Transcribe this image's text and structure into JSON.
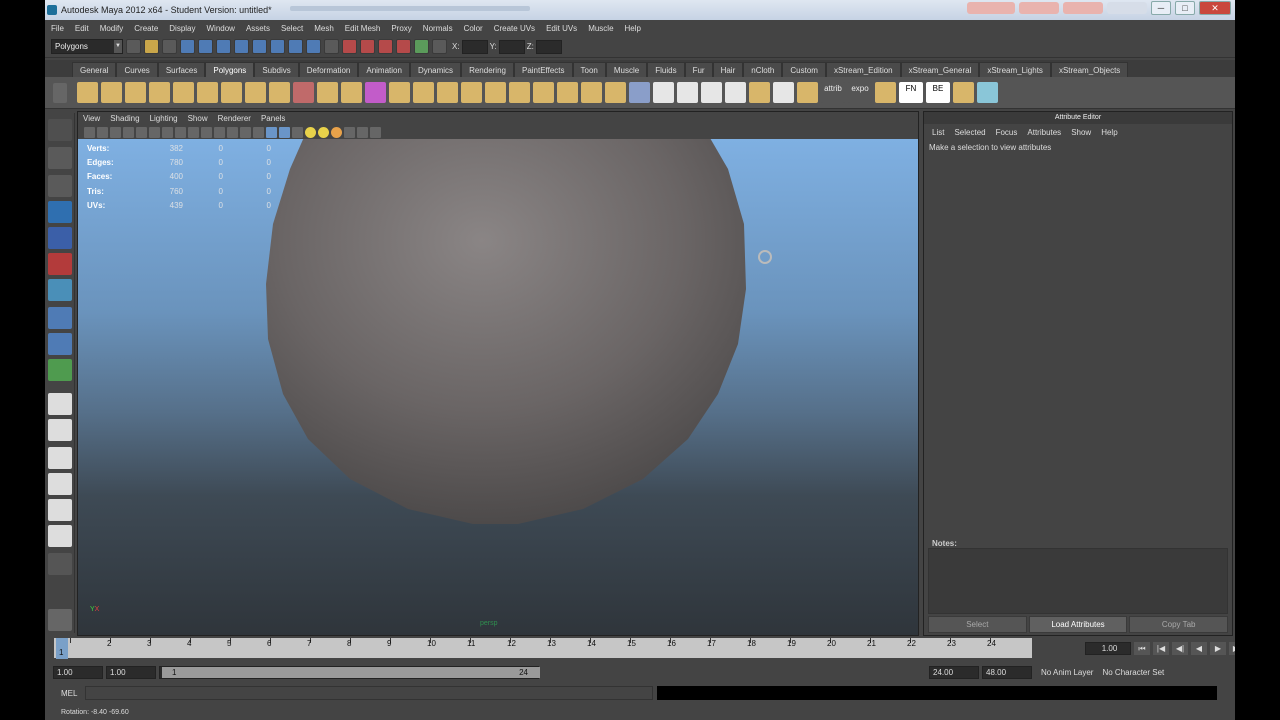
{
  "title_bar": {
    "text": "Autodesk Maya 2012 x64 - Student Version: untitled*",
    "minimize": "─",
    "maximize": "□",
    "close": "✕"
  },
  "menu": [
    "File",
    "Edit",
    "Modify",
    "Create",
    "Display",
    "Window",
    "Assets",
    "Select",
    "Mesh",
    "Edit Mesh",
    "Proxy",
    "Normals",
    "Color",
    "Create UVs",
    "Edit UVs",
    "Muscle",
    "Help"
  ],
  "status_line": {
    "mode": "Polygons",
    "x_label": "X:",
    "y_label": "Y:",
    "z_label": "Z:",
    "x_value": "",
    "y_value": "",
    "z_value": ""
  },
  "shelf_tabs": [
    "General",
    "Curves",
    "Surfaces",
    "Polygons",
    "Subdivs",
    "Deformation",
    "Animation",
    "Dynamics",
    "Rendering",
    "PaintEffects",
    "Toon",
    "Muscle",
    "Fluids",
    "Fur",
    "Hair",
    "nCloth",
    "Custom",
    "xStream_Edition",
    "xStream_General",
    "xStream_Lights",
    "xStream_Objects"
  ],
  "active_shelf_tab": "Polygons",
  "shelf_text_buttons": [
    "attrib",
    "expo",
    "FN",
    "BE"
  ],
  "viewport": {
    "menu": [
      "View",
      "Shading",
      "Lighting",
      "Show",
      "Renderer",
      "Panels"
    ],
    "hud": [
      {
        "label": "Verts:",
        "v1": "382",
        "v2": "0",
        "v3": "0"
      },
      {
        "label": "Edges:",
        "v1": "780",
        "v2": "0",
        "v3": "0"
      },
      {
        "label": "Faces:",
        "v1": "400",
        "v2": "0",
        "v3": "0"
      },
      {
        "label": "Tris:",
        "v1": "760",
        "v2": "0",
        "v3": "0"
      },
      {
        "label": "UVs:",
        "v1": "439",
        "v2": "0",
        "v3": "0"
      }
    ],
    "camera": "persp",
    "axis_y": "Y",
    "axis_x": "X"
  },
  "attribute_editor": {
    "title": "Attribute Editor",
    "menu": [
      "List",
      "Selected",
      "Focus",
      "Attributes",
      "Show",
      "Help"
    ],
    "message": "Make a selection to view attributes",
    "notes_label": "Notes:",
    "buttons": [
      "Select",
      "Load Attributes",
      "Copy Tab"
    ]
  },
  "time_slider": {
    "ticks": [
      "1",
      "2",
      "3",
      "4",
      "5",
      "6",
      "7",
      "8",
      "9",
      "10",
      "11",
      "12",
      "13",
      "14",
      "15",
      "16",
      "17",
      "18",
      "19",
      "20",
      "21",
      "22",
      "23",
      "24"
    ],
    "current_frame": "1",
    "current_field": "1.00"
  },
  "range_slider": {
    "start_time": "1.00",
    "playback_start": "1.00",
    "range_start_label": "1",
    "range_end_label": "24",
    "playback_end": "24.00",
    "end_time": "48.00",
    "anim_layer": "No Anim Layer",
    "character_set": "No Character Set"
  },
  "command_line": {
    "label": "MEL"
  },
  "help_line": "Rotation:  -8.40   -69.60",
  "colors": {
    "sky_top": "#7fb0e2",
    "ground": "#2f353b",
    "panel": "#444444"
  }
}
